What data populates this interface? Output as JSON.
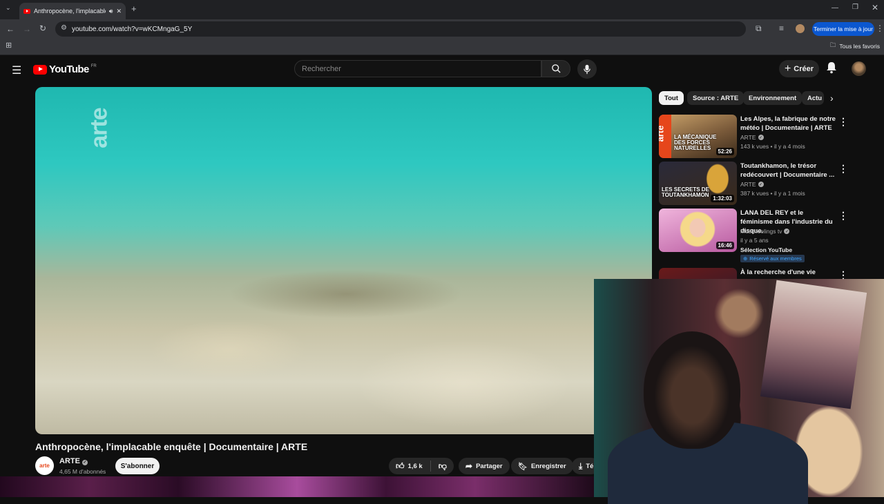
{
  "browser": {
    "tab_title": "Anthropocène, l'implacable",
    "url": "youtube.com/watch?v=wKCMngaG_5Y",
    "update_label": "Terminer la mise à jour",
    "all_bookmarks_label": "Tous les favoris"
  },
  "youtube": {
    "logo_text": "YouTube",
    "region": "FR",
    "search_placeholder": "Rechercher",
    "create_label": "Créer"
  },
  "video": {
    "watermark": "arte",
    "title": "Anthropocène, l'implacable enquête | Documentaire | ARTE",
    "channel": "ARTE",
    "channel_avatar_text": "arte",
    "subscribers": "4,65 M d'abonnés",
    "subscribe_label": "S'abonner",
    "likes": "1,6 k",
    "share_label": "Partager",
    "save_label": "Enregistrer",
    "download_label": "Télécharger"
  },
  "chips": [
    "Tout",
    "Source : ARTE",
    "Environnement",
    "Actu"
  ],
  "recommendations": [
    {
      "title": "Les Alpes, la fabrique de notre météo | Documentaire | ARTE",
      "channel": "ARTE",
      "views": "143 k vues",
      "age": "il y a 4 mois",
      "duration": "52:26",
      "thumb_text": "LA MÉCANIQUE DES FORCES NATURELLES",
      "thumb_color": "#7a5a3a"
    },
    {
      "title": "Toutankhamon, le trésor redécouvert | Documentaire ...",
      "channel": "ARTE",
      "views": "387 k vues",
      "age": "il y a 1 mois",
      "duration": "1:32:03",
      "thumb_text": "LES SECRETS DE TOUTANKHAMON",
      "thumb_color": "#3a2a1a"
    },
    {
      "title": "LANA DEL REY et le féminisme dans l'industrie du disque.",
      "channel": "Musicfeelings tv",
      "age_line": "il y a 5 ans",
      "selection": "Sélection YouTube",
      "badge": "Réservé aux membres",
      "duration": "16:46",
      "thumb_color": "#d98ac4"
    },
    {
      "title": "À la recherche d'une vie"
    }
  ]
}
